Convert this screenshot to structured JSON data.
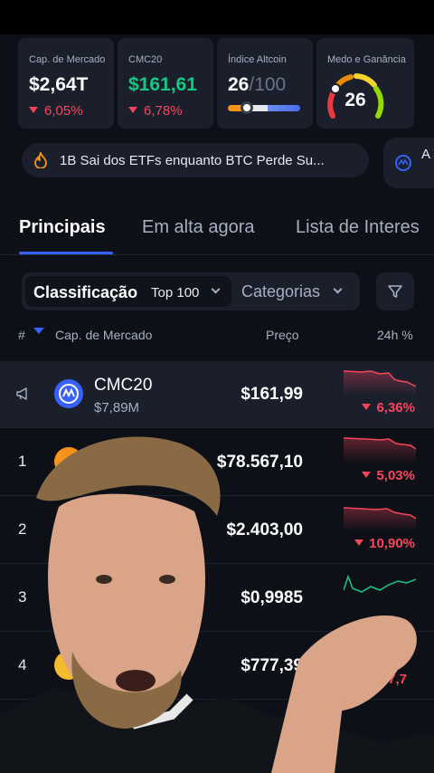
{
  "stats": [
    {
      "label": "Cap. de Mercado",
      "value": "$2,64T",
      "change": "6,05%"
    },
    {
      "label": "CMC20",
      "value": "$161,61",
      "change": "6,78%"
    },
    {
      "label": "Índice Altcoin",
      "value": "26",
      "value_suffix": "/100",
      "level_fraction": 0.26
    },
    {
      "label": "Medo e Ganância",
      "value": "26",
      "level_fraction": 0.26
    }
  ],
  "news": [
    {
      "icon": "fire-icon",
      "text": "1B Sai dos ETFs enquanto BTC Perde Su..."
    },
    {
      "icon": "coinmarketcap-icon",
      "text": "A re"
    }
  ],
  "tabs": [
    {
      "label": "Principais",
      "active": true
    },
    {
      "label": "Em alta agora",
      "active": false
    },
    {
      "label": "Lista de Interes",
      "active": false
    }
  ],
  "filters": {
    "sort_label": "Classificação",
    "sort_value": "Top 100",
    "category_label": "Categorias",
    "filter_icon": "filter-funnel-icon"
  },
  "table": {
    "headers": {
      "rank": "#",
      "name": "Cap. de Mercado",
      "price": "Preço",
      "change": "24h %"
    },
    "rows": [
      {
        "rank": "",
        "name": "CMC20",
        "sub": "$7,89M",
        "price": "$161,99",
        "change": "6,36%",
        "trend": "down",
        "icon": "cmc20-icon"
      },
      {
        "rank": "1",
        "name": "",
        "sub": "",
        "price": "$78.567,10",
        "change": "5,03%",
        "trend": "down",
        "icon": "bitcoin-icon"
      },
      {
        "rank": "2",
        "name": "",
        "sub": "",
        "price": "$2.403,00",
        "change": "10,90%",
        "trend": "down",
        "icon": "ethereum-icon"
      },
      {
        "rank": "3",
        "name": "",
        "sub": "",
        "price": "$0,9985",
        "change": "",
        "trend": "up",
        "icon": "stablecoin-icon"
      },
      {
        "rank": "4",
        "name": "",
        "sub": "",
        "price": "$777,39",
        "change": "7,7",
        "trend": "down",
        "icon": "bnb-icon"
      }
    ]
  },
  "colors": {
    "background": "#0d1017",
    "card": "#1a1f2b",
    "accent": "#3861fb",
    "down": "#f6465d",
    "up": "#16c784"
  }
}
